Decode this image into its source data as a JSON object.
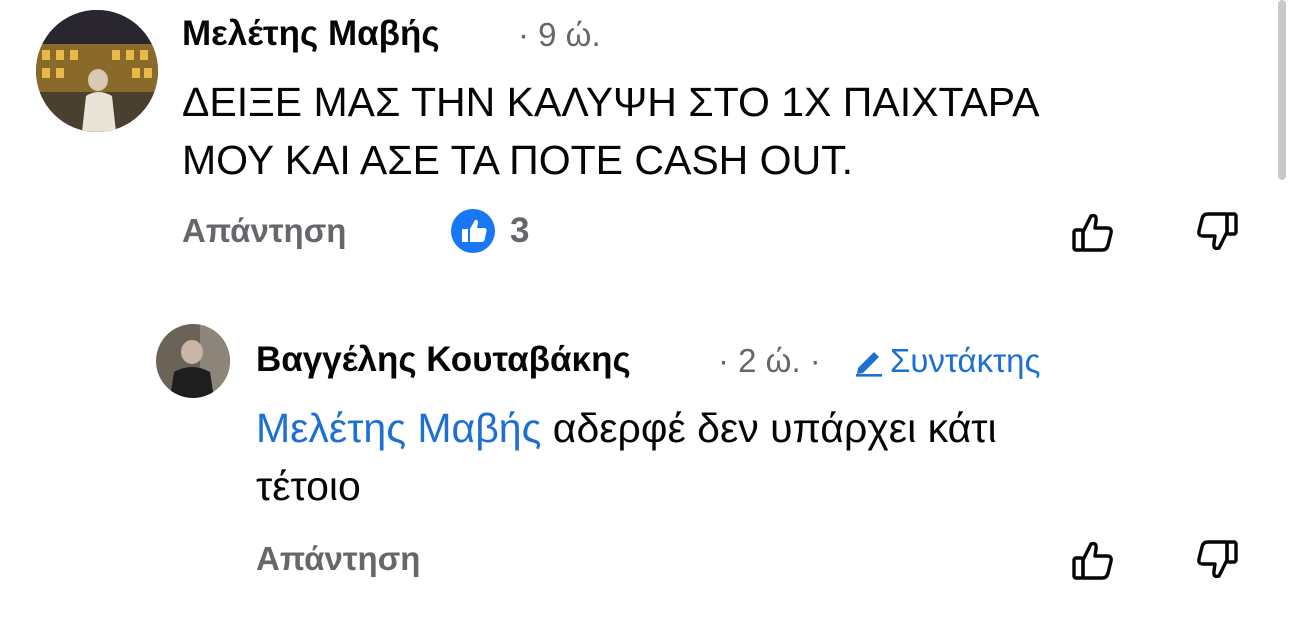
{
  "comments": [
    {
      "author": "Μελέτης Μαβής",
      "time": "· 9 ώ.",
      "line1": "ΔΕΙΞΕ ΜΑΣ ΤΗΝ ΚΑΛΥΨΗ ΣΤΟ 1Χ ΠΑΙΧΤΑΡΑ",
      "line2": "ΜΟΥ ΚΑΙ ΑΣΕ ΤΑ ΠΟΤΕ CASH OUT.",
      "reply_label": "Απάντηση",
      "like_count": "3"
    },
    {
      "author": "Βαγγέλης Κουταβάκης",
      "time": "· 2 ώ. ·",
      "role_label": "Συντάκτης",
      "mention": "Μελέτης Μαβής",
      "text_after_mention": " αδερφέ δεν υπάρχει κάτι",
      "line2": "τέτοιο",
      "reply_label": "Απάντηση"
    }
  ],
  "icons": [
    "like-reaction-icon",
    "thumbs-up-icon",
    "thumbs-down-icon",
    "pencil-icon"
  ],
  "colors": {
    "link": "#1c6fd3",
    "muted": "#65676b",
    "like_badge": "#1877f2"
  }
}
